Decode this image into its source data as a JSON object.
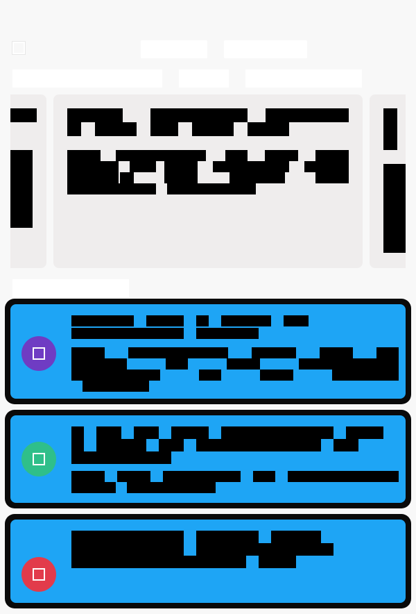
{
  "header": {
    "menu_icon": "square-icon",
    "tabs": [
      "",
      ""
    ],
    "subtabs": [
      "",
      "",
      ""
    ]
  },
  "carousel": {
    "slides": [
      {
        "title": "",
        "body": ""
      },
      {
        "title": "",
        "body": ""
      },
      {
        "title": "",
        "body": ""
      }
    ]
  },
  "section": {
    "label": ""
  },
  "feed": {
    "posts": [
      {
        "avatar_color": "#6f3cc3",
        "avatar_icon": "square-icon",
        "title": "",
        "body": ""
      },
      {
        "avatar_color": "#2fbf8a",
        "avatar_icon": "square-icon",
        "title": "",
        "body": ""
      },
      {
        "avatar_color": "#e23b4b",
        "avatar_icon": "square-icon",
        "title": "",
        "body": ""
      }
    ]
  },
  "colors": {
    "background": "#f8f8f8",
    "card": "#efeded",
    "post_bg": "#1ea5f5",
    "post_border": "#0a0a0a"
  }
}
